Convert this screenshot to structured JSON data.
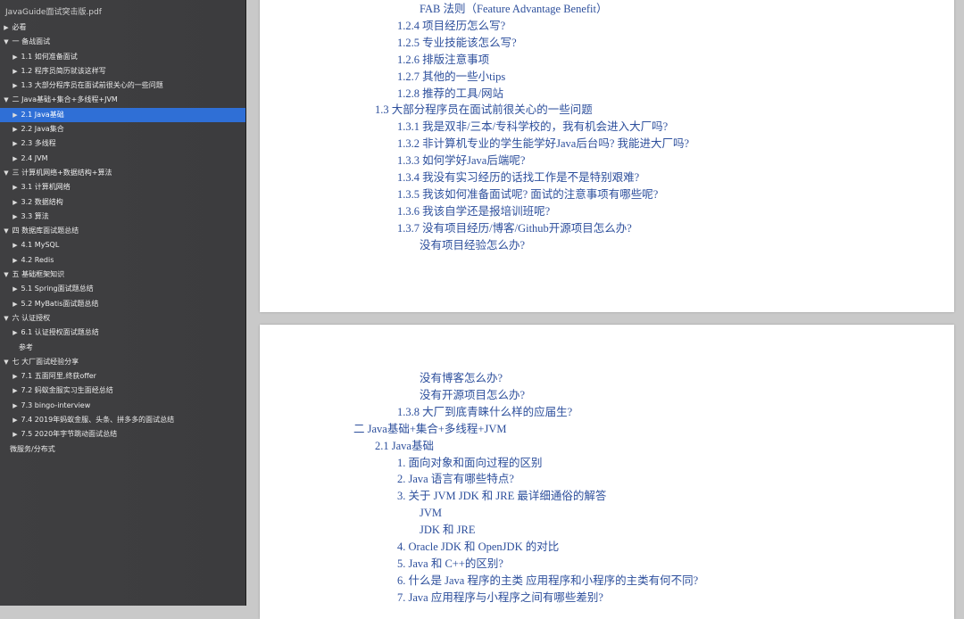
{
  "sidebar": {
    "title": "JavaGuide面试突击版.pdf",
    "items": [
      {
        "label": "必看",
        "tri": "▶",
        "level": "lvl0",
        "selected": false
      },
      {
        "label": "一 备战面试",
        "tri": "▼",
        "level": "lvl0",
        "selected": false
      },
      {
        "label": "1.1 如何准备面试",
        "tri": "▶",
        "level": "lvl1",
        "selected": false
      },
      {
        "label": "1.2 程序员简历就该这样写",
        "tri": "▶",
        "level": "lvl1",
        "selected": false
      },
      {
        "label": "1.3 大部分程序员在面试前很关心的一些问题",
        "tri": "▶",
        "level": "lvl1",
        "selected": false
      },
      {
        "label": "二 Java基础+集合+多线程+JVM",
        "tri": "▼",
        "level": "lvl0",
        "selected": false
      },
      {
        "label": "2.1 Java基础",
        "tri": "▶",
        "level": "lvl1",
        "selected": true
      },
      {
        "label": "2.2 Java集合",
        "tri": "▶",
        "level": "lvl1",
        "selected": false
      },
      {
        "label": "2.3 多线程",
        "tri": "▶",
        "level": "lvl1",
        "selected": false
      },
      {
        "label": "2.4 JVM",
        "tri": "▶",
        "level": "lvl1",
        "selected": false
      },
      {
        "label": "三 计算机网络+数据结构+算法",
        "tri": "▼",
        "level": "lvl0",
        "selected": false
      },
      {
        "label": "3.1 计算机网络",
        "tri": "▶",
        "level": "lvl1",
        "selected": false
      },
      {
        "label": "3.2 数据结构",
        "tri": "▶",
        "level": "lvl1",
        "selected": false
      },
      {
        "label": "3.3 算法",
        "tri": "▶",
        "level": "lvl1",
        "selected": false
      },
      {
        "label": "四 数据库面试题总结",
        "tri": "▼",
        "level": "lvl0",
        "selected": false
      },
      {
        "label": "4.1 MySQL",
        "tri": "▶",
        "level": "lvl1",
        "selected": false
      },
      {
        "label": "4.2 Redis",
        "tri": "▶",
        "level": "lvl1",
        "selected": false
      },
      {
        "label": "五 基础框架知识",
        "tri": "▼",
        "level": "lvl0",
        "selected": false
      },
      {
        "label": "5.1 Spring面试题总结",
        "tri": "▶",
        "level": "lvl1",
        "selected": false
      },
      {
        "label": "5.2 MyBatis面试题总结",
        "tri": "▶",
        "level": "lvl1",
        "selected": false
      },
      {
        "label": "六 认证授权",
        "tri": "▼",
        "level": "lvl0",
        "selected": false
      },
      {
        "label": "6.1 认证授权面试题总结",
        "tri": "▶",
        "level": "lvl1",
        "selected": false
      },
      {
        "label": "参考",
        "tri": "",
        "level": "lvl1b",
        "selected": false
      },
      {
        "label": "七 大厂面试经验分享",
        "tri": "▼",
        "level": "lvl0",
        "selected": false
      },
      {
        "label": "7.1 五面阿里,终获offer",
        "tri": "▶",
        "level": "lvl1",
        "selected": false
      },
      {
        "label": "7.2 蚂蚁金服实习生面经总结",
        "tri": "▶",
        "level": "lvl1",
        "selected": false
      },
      {
        "label": "7.3 bingo-interview",
        "tri": "▶",
        "level": "lvl1",
        "selected": false
      },
      {
        "label": "7.4 2019年蚂蚁金服、头条、拼多多的面试总结",
        "tri": "▶",
        "level": "lvl1",
        "selected": false
      },
      {
        "label": "7.5 2020年字节跳动面试总结",
        "tri": "▶",
        "level": "lvl1",
        "selected": false
      },
      {
        "label": "微服务/分布式",
        "tri": "",
        "level": "lvl0b",
        "selected": false
      }
    ]
  },
  "page1": {
    "lines": [
      {
        "text": "FAB 法则（Feature Advantage Benefit）",
        "indent": 3
      },
      {
        "text": "1.2.4 项目经历怎么写?",
        "indent": 2
      },
      {
        "text": "1.2.5 专业技能该怎么写?",
        "indent": 2
      },
      {
        "text": "1.2.6 排版注意事项",
        "indent": 2
      },
      {
        "text": "1.2.7 其他的一些小tips",
        "indent": 2
      },
      {
        "text": "1.2.8 推荐的工具/网站",
        "indent": 2
      },
      {
        "text": "1.3 大部分程序员在面试前很关心的一些问题",
        "indent": 1
      },
      {
        "text": "1.3.1 我是双非/三本/专科学校的，我有机会进入大厂吗?",
        "indent": 2
      },
      {
        "text": "1.3.2 非计算机专业的学生能学好Java后台吗? 我能进大厂吗?",
        "indent": 2
      },
      {
        "text": "1.3.3 如何学好Java后端呢?",
        "indent": 2
      },
      {
        "text": "1.3.4 我没有实习经历的话找工作是不是特别艰难?",
        "indent": 2
      },
      {
        "text": "1.3.5 我该如何准备面试呢? 面试的注意事项有哪些呢?",
        "indent": 2
      },
      {
        "text": "1.3.6 我该自学还是报培训班呢?",
        "indent": 2
      },
      {
        "text": "1.3.7 没有项目经历/博客/Github开源项目怎么办?",
        "indent": 2
      },
      {
        "text": "没有项目经验怎么办?",
        "indent": 3
      }
    ]
  },
  "page2": {
    "lines": [
      {
        "text": "没有博客怎么办?",
        "indent": 3
      },
      {
        "text": "没有开源项目怎么办?",
        "indent": 3
      },
      {
        "text": "1.3.8 大厂到底青睐什么样的应届生?",
        "indent": 2
      },
      {
        "text": "二 Java基础+集合+多线程+JVM",
        "indent": 0
      },
      {
        "text": "2.1 Java基础",
        "indent": 1
      },
      {
        "text": "1. 面向对象和面向过程的区别",
        "indent": 2
      },
      {
        "text": "2. Java 语言有哪些特点?",
        "indent": 2
      },
      {
        "text": "3. 关于 JVM JDK 和 JRE 最详细通俗的解答",
        "indent": 2
      },
      {
        "text": "JVM",
        "indent": 3
      },
      {
        "text": "JDK 和 JRE",
        "indent": 3
      },
      {
        "text": "4. Oracle JDK 和 OpenJDK 的对比",
        "indent": 2
      },
      {
        "text": "5. Java 和 C++的区别?",
        "indent": 2
      },
      {
        "text": "6. 什么是 Java 程序的主类 应用程序和小程序的主类有何不同?",
        "indent": 2
      },
      {
        "text": "7. Java 应用程序与小程序之间有哪些差别?",
        "indent": 2
      }
    ]
  },
  "colors": {
    "link": "#2d4f9c",
    "selection": "#2f6fd6",
    "sidebar": "#3f3f41"
  }
}
